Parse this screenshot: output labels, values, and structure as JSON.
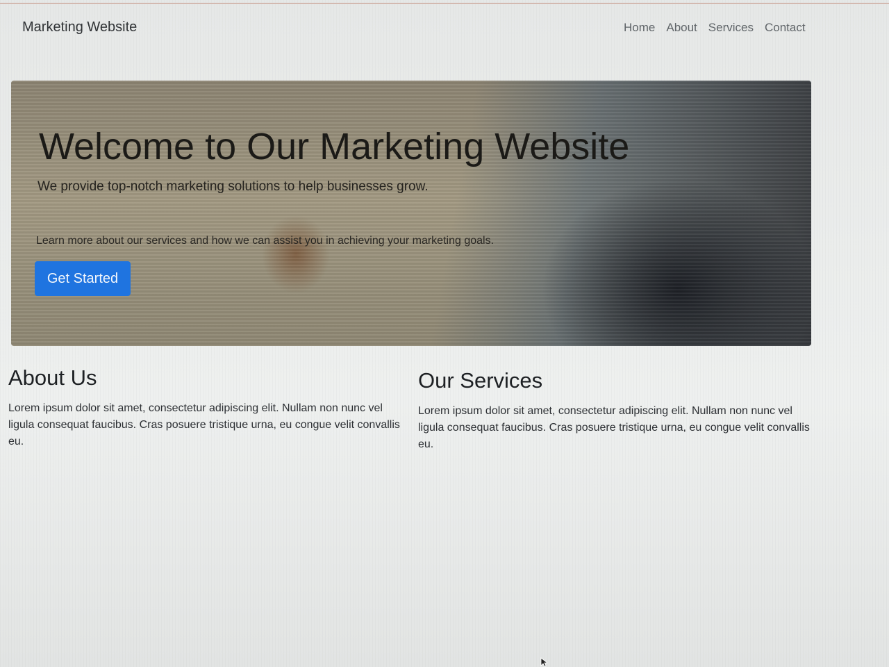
{
  "navbar": {
    "brand": "Marketing Website",
    "links": [
      {
        "label": "Home"
      },
      {
        "label": "About"
      },
      {
        "label": "Services"
      },
      {
        "label": "Contact"
      }
    ]
  },
  "hero": {
    "title": "Welcome to Our Marketing Website",
    "subtitle": "We provide top-notch marketing solutions to help businesses grow.",
    "text": "Learn more about our services and how we can assist you in achieving your marketing goals.",
    "cta_label": "Get Started"
  },
  "about": {
    "heading": "About Us",
    "body": "Lorem ipsum dolor sit amet, consectetur adipiscing elit. Nullam non nunc vel ligula consequat faucibus. Cras posuere tristique urna, eu congue velit convallis eu."
  },
  "services": {
    "heading": "Our Services",
    "body": "Lorem ipsum dolor sit amet, consectetur adipiscing elit. Nullam non nunc vel ligula consequat faucibus. Cras posuere tristique urna, eu congue velit convallis eu."
  },
  "colors": {
    "accent": "#1f74e0",
    "background": "#e9ebea"
  },
  "icons": {
    "cursor": "mouse-pointer-icon"
  }
}
